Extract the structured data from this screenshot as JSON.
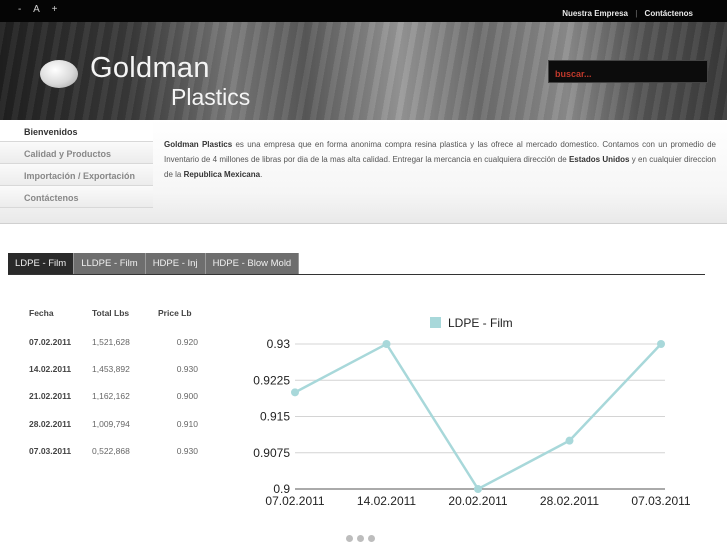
{
  "topbar": {
    "font_controls": [
      "-",
      "A",
      "+"
    ],
    "nav": [
      "Nuestra Empresa",
      "Contáctenos"
    ]
  },
  "header": {
    "logo_word1": "Goldman",
    "logo_word2": "Plastics",
    "search_placeholder": "buscar..."
  },
  "sidebar": {
    "items": [
      {
        "label": "Bienvenidos",
        "active": true
      },
      {
        "label": "Calidad y Productos",
        "active": false
      },
      {
        "label": "Importación / Exportación",
        "active": false
      },
      {
        "label": "Contáctenos",
        "active": false
      }
    ]
  },
  "intro": {
    "brand": "Goldman Plastics",
    "text1": " es una empresa que en forma anonima compra resina plastica y las ofrece al mercado domestico. Contamos con un promedio de Inventario de 4 millones de libras por dia de la mas alta calidad. Entregar la mercancia en cualquiera dirección de ",
    "country1": "Estados Unidos",
    "text2": " y en cualquier direccion de la ",
    "country2": "Republica Mexicana",
    "text3": "."
  },
  "tabs": [
    {
      "label": "LDPE - Film",
      "active": true
    },
    {
      "label": "LLDPE - Film",
      "active": false
    },
    {
      "label": "HDPE - Inj",
      "active": false
    },
    {
      "label": "HDPE - Blow Mold",
      "active": false
    }
  ],
  "table": {
    "headers": [
      "Fecha",
      "Total Lbs",
      "Price Lb"
    ],
    "rows": [
      [
        "07.02.2011",
        "1,521,628",
        "0.920"
      ],
      [
        "14.02.2011",
        "1,453,892",
        "0.930"
      ],
      [
        "21.02.2011",
        "1,162,162",
        "0.900"
      ],
      [
        "28.02.2011",
        "1,009,794",
        "0.910"
      ],
      [
        "07.03.2011",
        "0,522,868",
        "0.930"
      ]
    ]
  },
  "chart_data": {
    "type": "line",
    "x": [
      "07.02.2011",
      "14.02.2011",
      "20.02.2011",
      "28.02.2011",
      "07.03.2011"
    ],
    "series": [
      {
        "name": "LDPE - Film",
        "values": [
          0.92,
          0.93,
          0.9,
          0.91,
          0.93
        ],
        "color": "#a8d8da"
      }
    ],
    "yticks": [
      0.93,
      0.9225,
      0.915,
      0.9075,
      0.9
    ],
    "ytick_labels": [
      "0.93",
      "0.9225",
      "0.915",
      "0.9075",
      "0.9"
    ],
    "ylim": [
      0.9,
      0.93
    ],
    "grid": true,
    "legend": "top"
  },
  "pager": {
    "count": 3
  }
}
